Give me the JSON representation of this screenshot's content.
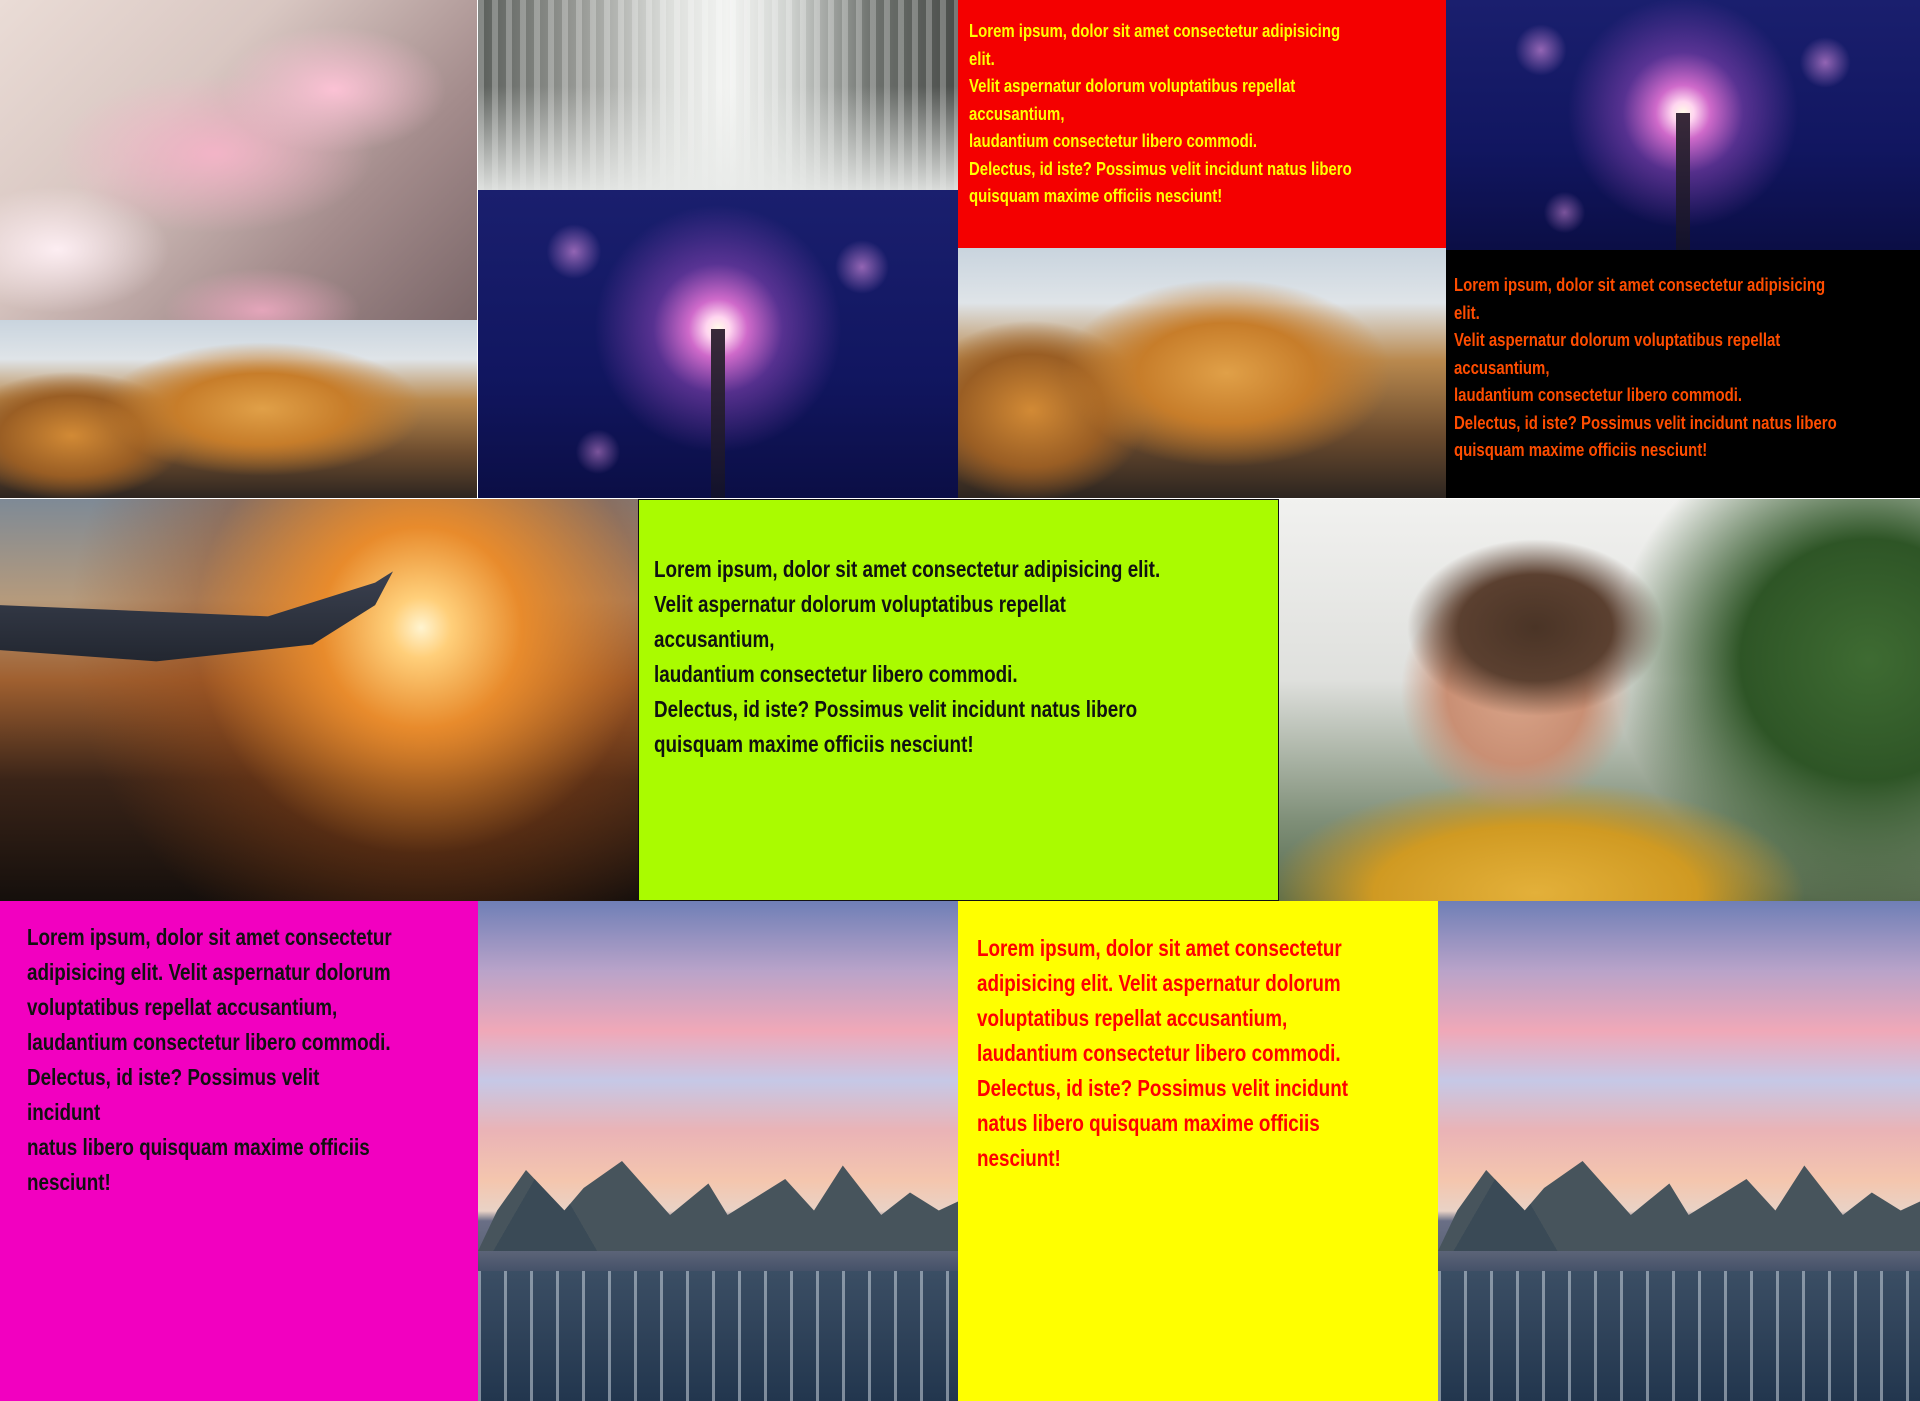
{
  "colors": {
    "red_panel": "#f40000",
    "black_panel": "#000000",
    "lime_panel": "#aafb00",
    "magenta_panel": "#f200c0",
    "yellow_panel": "#ffff00",
    "red_panel_text": "#ffff00",
    "black_panel_text": "#ff4d00",
    "lime_panel_text": "#111111",
    "magenta_panel_text": "#111111",
    "yellow_panel_text": "#ff0000"
  },
  "images": [
    "cherry-blossom-photo",
    "waterfall-photo",
    "sparkler-photo",
    "mountain-sunset-photo",
    "airplane-wing-sunset-photo",
    "woman-with-camera-photo",
    "overwater-bungalows-photo"
  ],
  "panels": {
    "red": {
      "text": "Lorem ipsum, dolor sit amet consectetur adipisicing elit.\nVelit aspernatur dolorum voluptatibus repellat accusantium,\n laudantium consectetur libero commodi.\nDelectus, id iste? Possimus velit incidunt natus libero\n quisquam maxime officiis nesciunt!"
    },
    "black": {
      "text": "Lorem ipsum, dolor sit amet consectetur adipisicing elit.\nVelit aspernatur dolorum voluptatibus repellat accusantium,\n laudantium consectetur libero commodi.\nDelectus, id iste? Possimus velit incidunt natus libero\n quisquam maxime officiis nesciunt!"
    },
    "lime": {
      "text": "Lorem ipsum, dolor sit amet consectetur adipisicing elit.\nVelit aspernatur dolorum voluptatibus repellat accusantium,\n laudantium consectetur libero commodi.\nDelectus, id iste? Possimus velit incidunt natus libero\n quisquam maxime officiis nesciunt!"
    },
    "magenta": {
      "text": "Lorem ipsum, dolor sit amet consectetur\nadipisicing elit. Velit aspernatur dolorum\nvoluptatibus repellat accusantium,\n laudantium consectetur libero commodi.\nDelectus, id iste? Possimus velit incidunt\nnatus libero quisquam maxime officiis\nnesciunt!"
    },
    "yellow": {
      "text": "Lorem ipsum, dolor sit amet consectetur\nadipisicing elit. Velit aspernatur dolorum\nvoluptatibus repellat accusantium,\n laudantium consectetur libero commodi.\nDelectus, id iste? Possimus velit incidunt\nnatus libero quisquam maxime officiis\nnesciunt!"
    }
  }
}
